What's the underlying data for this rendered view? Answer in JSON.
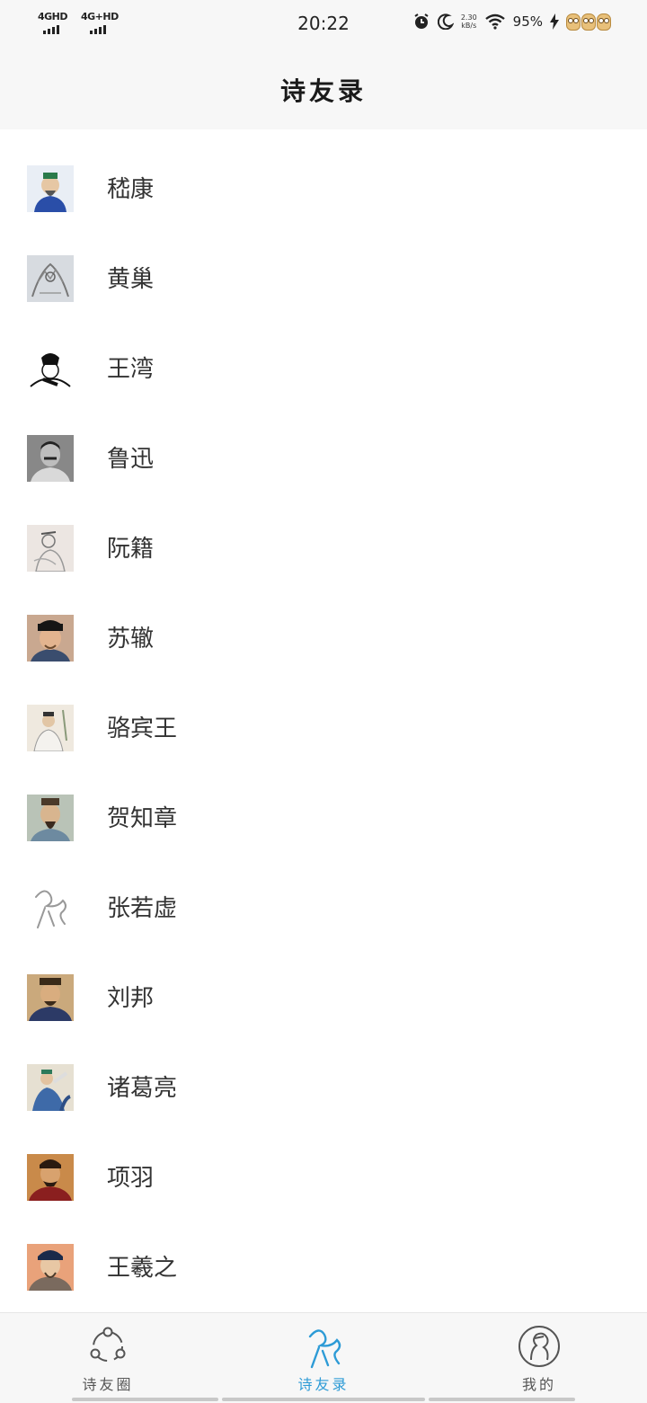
{
  "status_bar": {
    "network1": "4GHD",
    "network2": "4G+HD",
    "time": "20:22",
    "speed_value": "2.30",
    "speed_unit": "kB/s",
    "battery": "95%"
  },
  "nav": {
    "title": "诗友录"
  },
  "contacts": [
    {
      "name": "嵇康"
    },
    {
      "name": "黄巢"
    },
    {
      "name": "王湾"
    },
    {
      "name": "鲁迅"
    },
    {
      "name": "阮籍"
    },
    {
      "name": "苏辙"
    },
    {
      "name": "骆宾王"
    },
    {
      "name": "贺知章"
    },
    {
      "name": "张若虚"
    },
    {
      "name": "刘邦"
    },
    {
      "name": "诸葛亮"
    },
    {
      "name": "项羽"
    },
    {
      "name": "王羲之"
    }
  ],
  "tabs": [
    {
      "label": "诗友圈",
      "icon": "share-circle-icon",
      "active": false
    },
    {
      "label": "诗友录",
      "icon": "poet-figure-icon",
      "active": true
    },
    {
      "label": "我的",
      "icon": "profile-portrait-icon",
      "active": false
    }
  ],
  "colors": {
    "accent": "#2d9bd6",
    "bar_bg": "#f7f7f7"
  }
}
